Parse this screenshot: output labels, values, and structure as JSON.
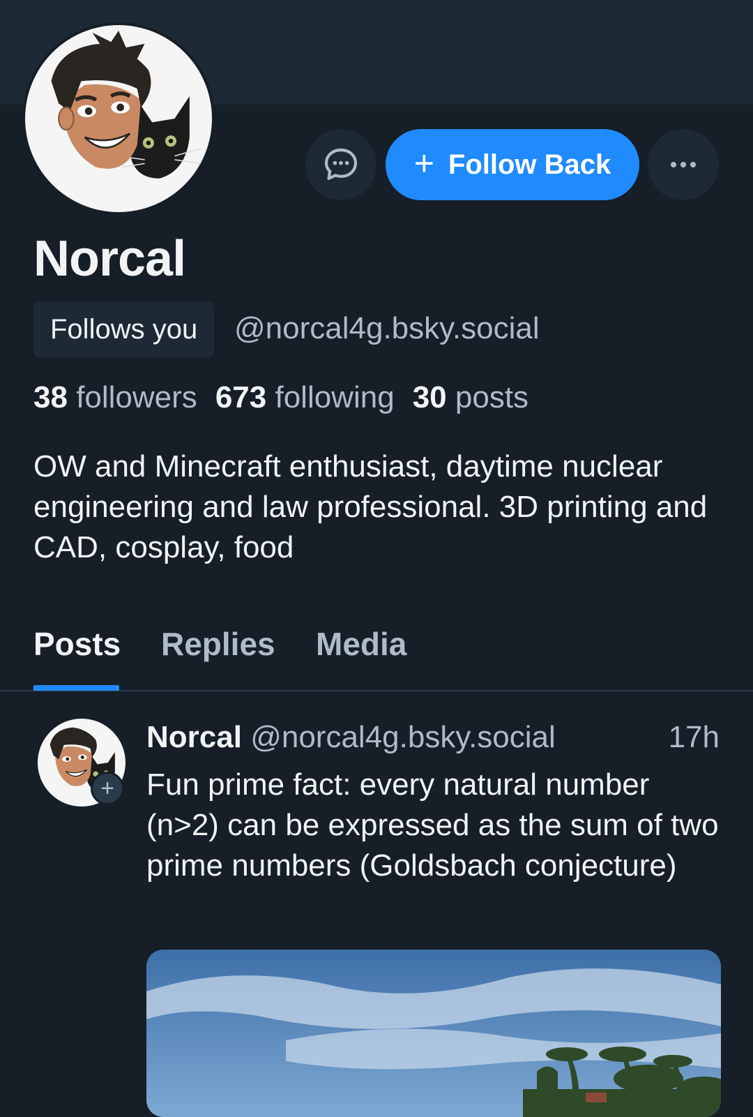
{
  "profile": {
    "display_name": "Norcal",
    "follows_you_label": "Follows you",
    "handle": "@norcal4g.bsky.social",
    "followers_count": "38",
    "followers_label": "followers",
    "following_count": "673",
    "following_label": "following",
    "posts_count": "30",
    "posts_label": "posts",
    "bio": "OW and Minecraft enthusiast, daytime nuclear engineering and law professional. 3D printing and CAD, cosplay, food"
  },
  "actions": {
    "message_icon": "chat-bubble-icon",
    "follow_back_label": "Follow Back",
    "more_icon": "ellipsis-icon"
  },
  "tabs": [
    {
      "label": "Posts",
      "active": true
    },
    {
      "label": "Replies",
      "active": false
    },
    {
      "label": "Media",
      "active": false
    }
  ],
  "post": {
    "author_name": "Norcal",
    "author_handle": "@norcal4g.bsky.social",
    "time": "17h",
    "text": "Fun prime fact: every natural number (n>2) can be expressed as the sum of two prime numbers (Goldsbach conjecture)",
    "image_icon": "beach-photo"
  },
  "colors": {
    "background": "#161e27",
    "banner": "#1e2936",
    "accent": "#208bfe",
    "muted_text": "#aebbc9"
  }
}
